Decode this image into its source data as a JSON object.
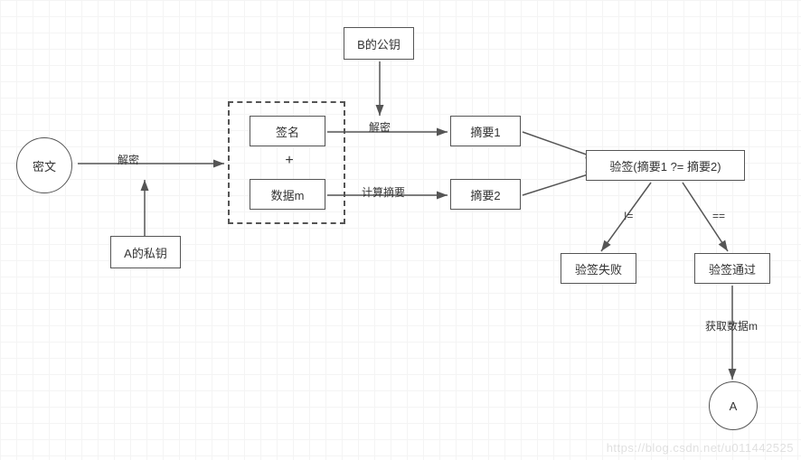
{
  "nodes": {
    "ciphertext": "密文",
    "a_priv_key": "A的私钥",
    "b_pub_key": "B的公钥",
    "signature": "签名",
    "data_m": "数据m",
    "digest1": "摘要1",
    "digest2": "摘要2",
    "verify": "验签(摘要1 ?= 摘要2)",
    "verify_fail": "验签失败",
    "verify_pass": "验签通过",
    "end_a": "A",
    "plus": "+"
  },
  "edges": {
    "decrypt1": "解密",
    "decrypt2": "解密",
    "compute_digest": "计算摘要",
    "neq": "!=",
    "eq": "==",
    "get_data": "获取数据m"
  },
  "watermark": "https://blog.csdn.net/u011442525"
}
